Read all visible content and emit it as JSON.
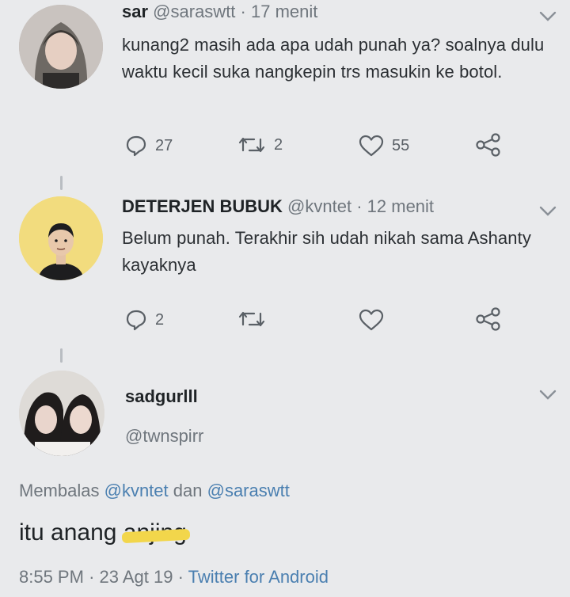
{
  "tweets": [
    {
      "name": "sar",
      "handle": "@saraswtt",
      "time": "17 menit",
      "text": "kunang2 masih ada apa udah punah ya? soalnya dulu waktu kecil suka nangkepin trs masukin ke botol.",
      "replies": "27",
      "retweets": "2",
      "likes": "55"
    },
    {
      "name": "DETERJEN BUBUK",
      "handle": "@kvntet",
      "time": "12 menit",
      "text": "Belum punah. Terakhir sih udah nikah sama Ashanty kayaknya",
      "replies": "2",
      "retweets": "",
      "likes": ""
    }
  ],
  "main_tweet": {
    "name": "sadgurlll",
    "handle": "@twnspirr",
    "replying_prefix": "Membalas",
    "replying_user1": "@kvntet",
    "replying_and": "dan",
    "replying_user2": "@saraswtt",
    "text": "itu anang ",
    "censored": "anjing",
    "time": "8:55 PM",
    "date": "23 Agt 19",
    "source": "Twitter for Android"
  },
  "colors": {
    "background": "#e9eaec",
    "link": "#4a7fb0",
    "muted": "#6f767d",
    "scribble": "#f2d64b"
  },
  "icons": [
    "reply-icon",
    "retweet-icon",
    "like-icon",
    "share-icon",
    "chevron-down-icon"
  ]
}
